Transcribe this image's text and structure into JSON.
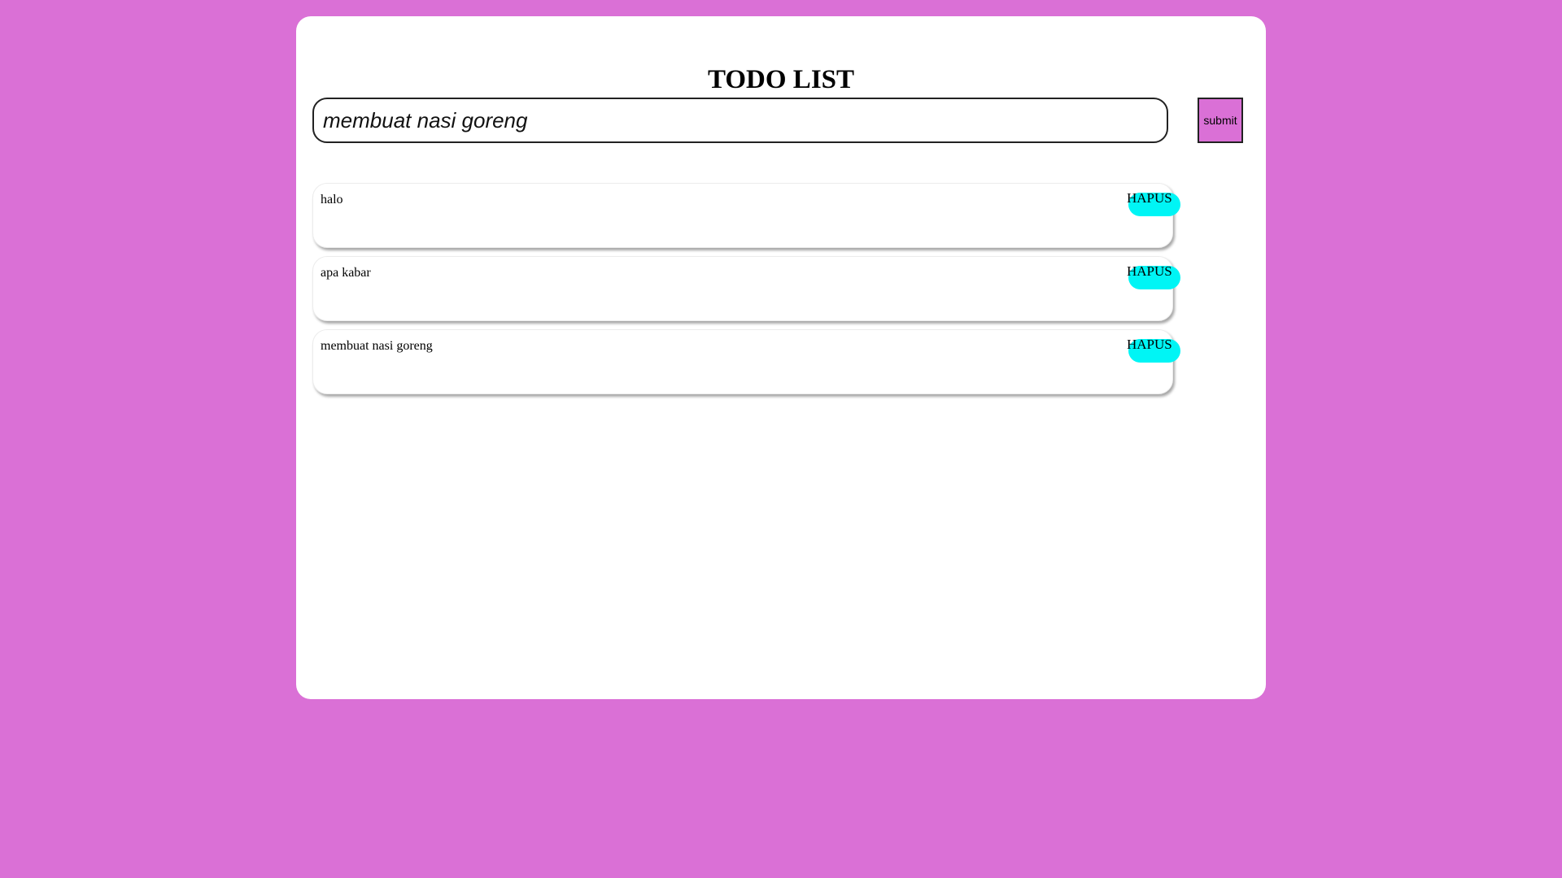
{
  "app": {
    "title": "TODO LIST"
  },
  "form": {
    "input_value": "membuat nasi goreng",
    "submit_label": "submit"
  },
  "todos": [
    {
      "text": "halo",
      "delete_label": "HAPUS"
    },
    {
      "text": "apa kabar",
      "delete_label": "HAPUS"
    },
    {
      "text": "membuat nasi goreng",
      "delete_label": "HAPUS"
    }
  ],
  "colors": {
    "page_background": "#da70d6",
    "card_background": "#ffffff",
    "submit_button": "#da70d6",
    "delete_button": "#00f5f5"
  }
}
